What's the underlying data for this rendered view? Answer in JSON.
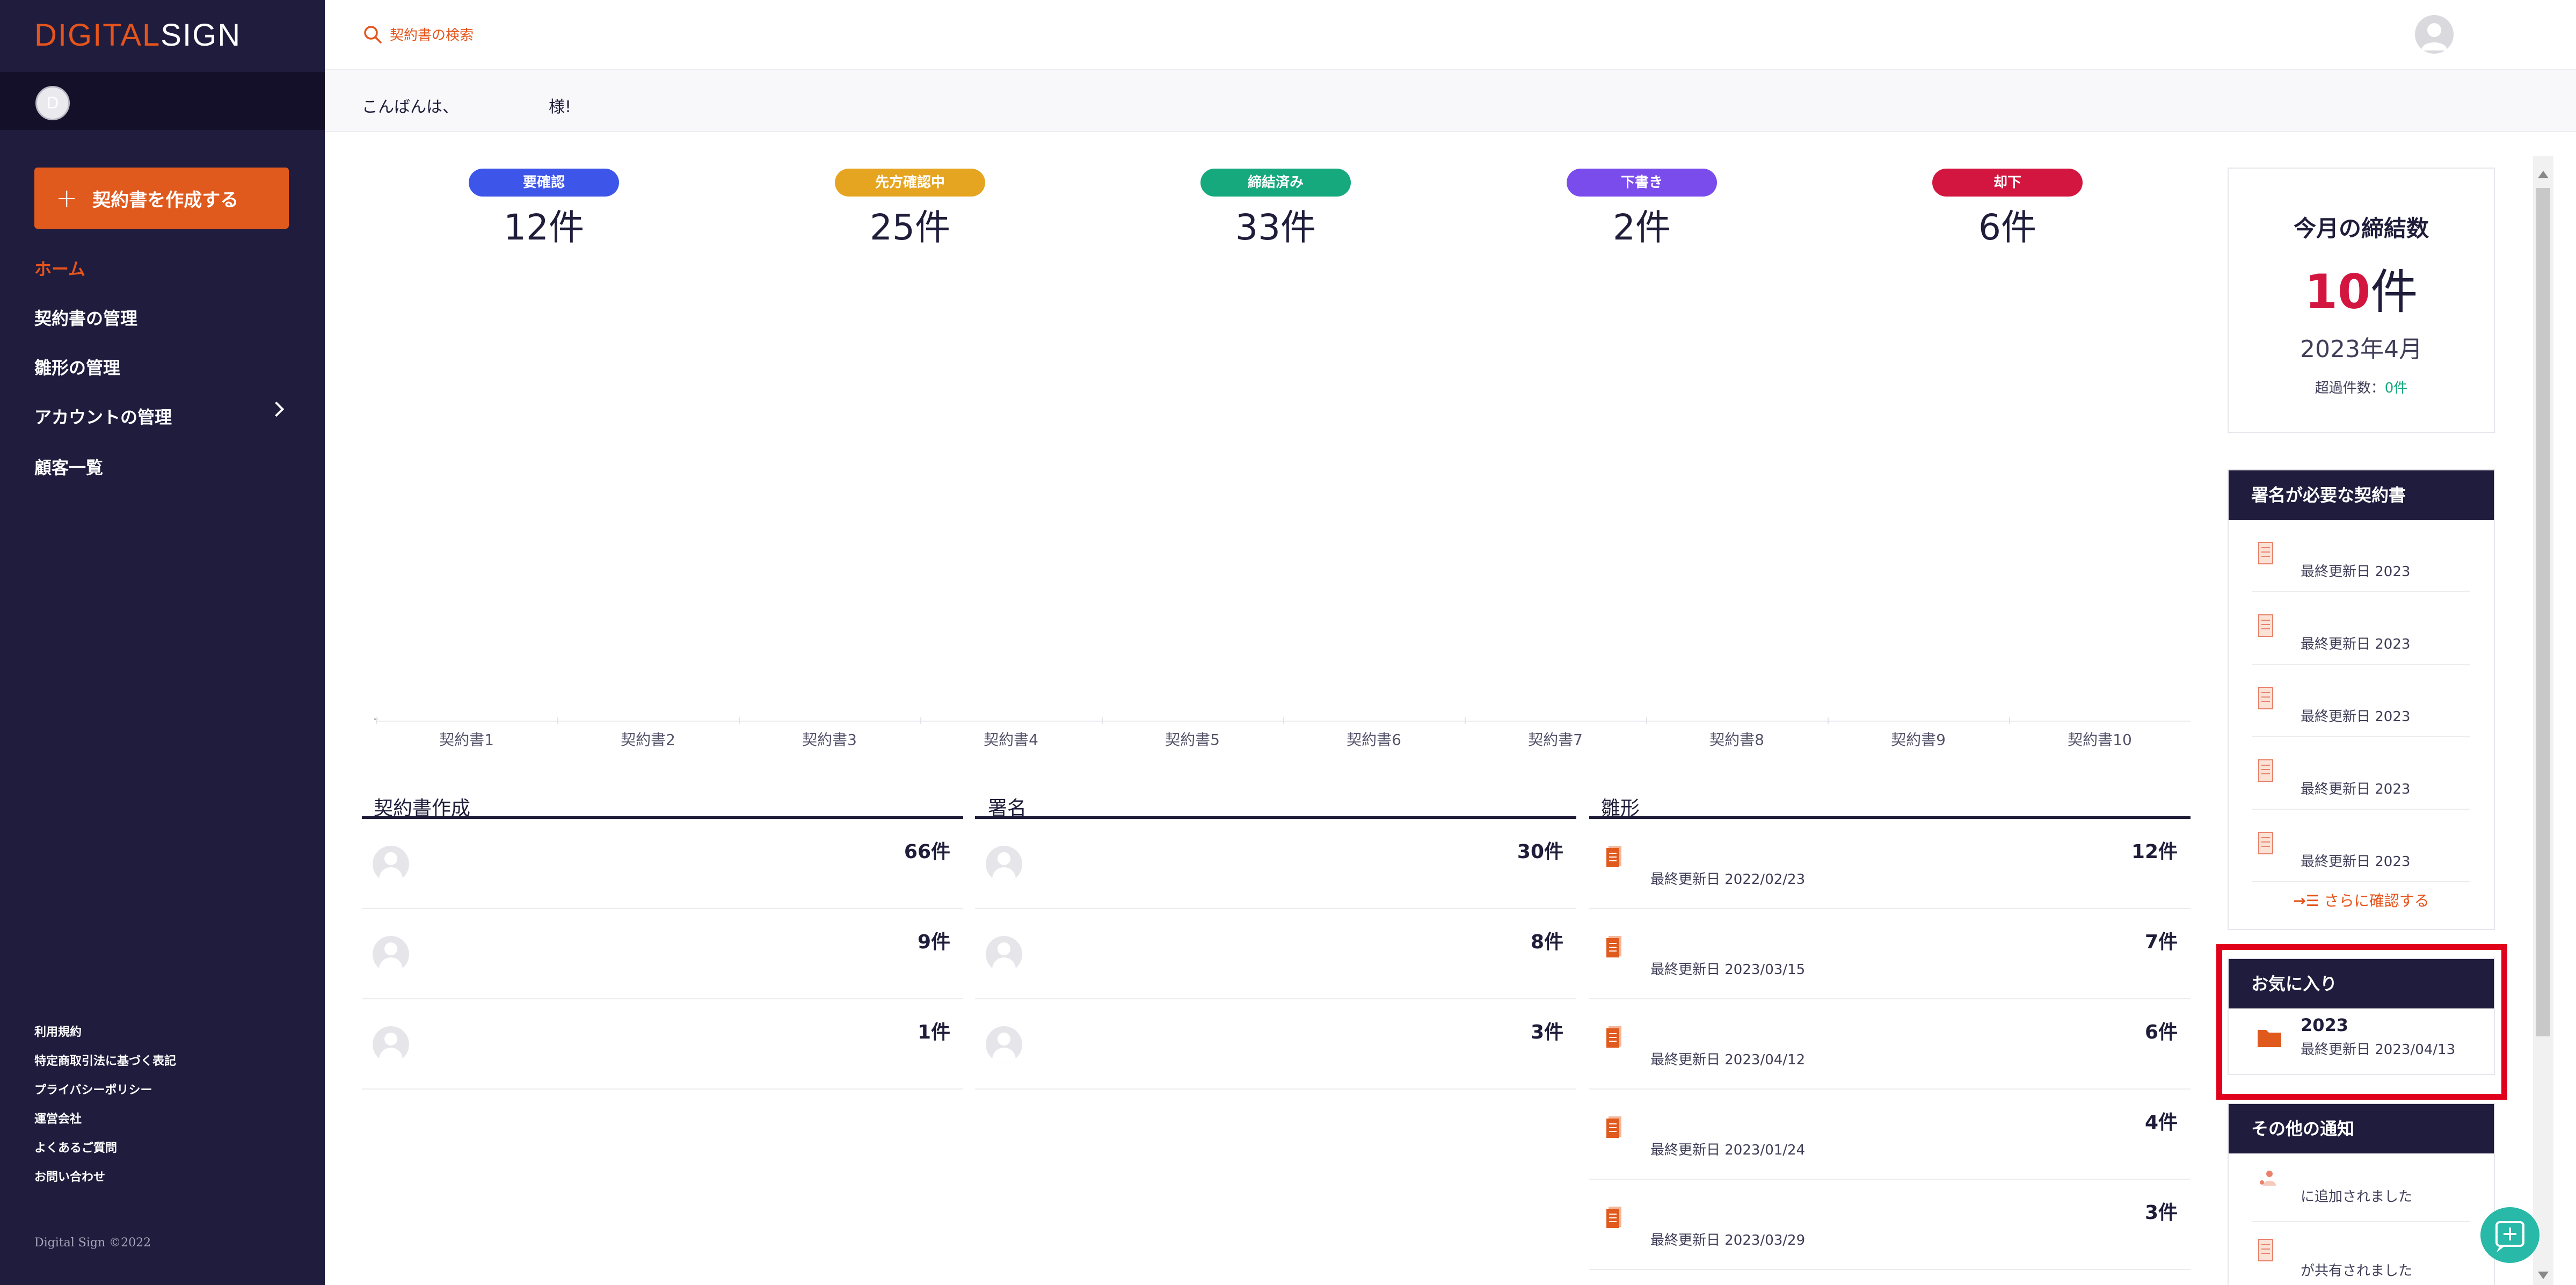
{
  "sidebar": {
    "logo_part1": "DIGITAL",
    "logo_part2": "SIGN",
    "user_initial": "D",
    "create_button": "契約書を作成する",
    "nav": [
      {
        "label": "ホーム"
      },
      {
        "label": "契約書の管理"
      },
      {
        "label": "雛形の管理"
      },
      {
        "label": "アカウントの管理"
      },
      {
        "label": "顧客一覧"
      }
    ],
    "footer_links": [
      "利用規約",
      "特定商取引法に基づく表記",
      "プライバシーポリシー",
      "運営会社",
      "よくあるご質問",
      "お問い合わせ"
    ],
    "copyright": "Digital Sign ©2022"
  },
  "topbar": {
    "search_placeholder": "契約書の検索"
  },
  "greeting": {
    "prefix": "こんばんは、",
    "suffix": "様!"
  },
  "status_counts": [
    {
      "label": "要確認",
      "count": "12件",
      "color": "#3d55e8"
    },
    {
      "label": "先方確認中",
      "count": "25件",
      "color": "#e6a521"
    },
    {
      "label": "締結済み",
      "count": "33件",
      "color": "#16a97e"
    },
    {
      "label": "下書き",
      "count": "2件",
      "color": "#7b4cec"
    },
    {
      "label": "却下",
      "count": "6件",
      "color": "#d2163f"
    }
  ],
  "chart_data": {
    "type": "bar",
    "categories": [
      "契約書1",
      "契約書2",
      "契約書3",
      "契約書4",
      "契約書5",
      "契約書6",
      "契約書7",
      "契約書8",
      "契約書9",
      "契約書10"
    ],
    "y_tick_label": "-",
    "grid": false
  },
  "columns": {
    "contract_creation": {
      "title": "契約書作成",
      "rows": [
        {
          "count": "66件"
        },
        {
          "count": "9件"
        },
        {
          "count": "1件"
        }
      ]
    },
    "signature": {
      "title": "署名",
      "rows": [
        {
          "count": "30件"
        },
        {
          "count": "8件"
        },
        {
          "count": "3件"
        }
      ]
    },
    "template": {
      "title": "雛形",
      "rows": [
        {
          "count": "12件",
          "date": "最終更新日 2022/02/23"
        },
        {
          "count": "7件",
          "date": "最終更新日 2023/03/15"
        },
        {
          "count": "6件",
          "date": "最終更新日 2023/04/12"
        },
        {
          "count": "4件",
          "date": "最終更新日 2023/01/24"
        },
        {
          "count": "3件",
          "date": "最終更新日 2023/03/29"
        }
      ]
    }
  },
  "monthly": {
    "title": "今月の締結数",
    "count_number": "10",
    "count_unit": "件",
    "month": "2023年4月",
    "over_label": "超過件数：",
    "over_value": "0件",
    "over_color": "#16a97e",
    "count_color": "#d2163f"
  },
  "needs_signature": {
    "title": "署名が必要な契約書",
    "items": [
      {
        "text": "最終更新日 2023"
      },
      {
        "text": "最終更新日 2023"
      },
      {
        "text": "最終更新日 2023"
      },
      {
        "text": "最終更新日 2023"
      },
      {
        "text": "最終更新日 2023"
      }
    ],
    "more": "さらに確認する"
  },
  "favorites": {
    "title": "お気に入り",
    "items": [
      {
        "name": "2023",
        "date": "最終更新日 2023/04/13"
      }
    ]
  },
  "other_notifications": {
    "title": "その他の通知",
    "items": [
      {
        "text": "に追加されました"
      },
      {
        "text": "が共有されました"
      }
    ]
  }
}
